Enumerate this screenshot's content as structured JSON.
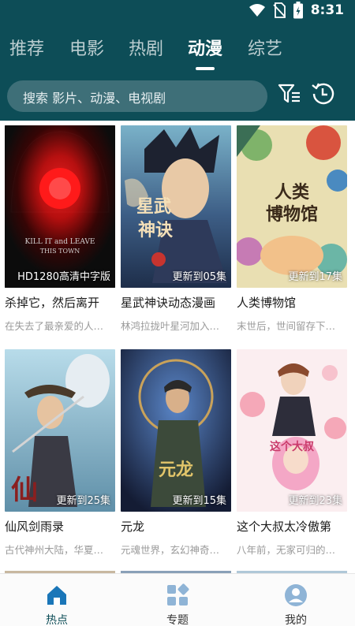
{
  "status_bar": {
    "time": "8:31",
    "icons": [
      "wifi-icon",
      "no-sim-icon",
      "battery-icon"
    ]
  },
  "tabs": [
    {
      "label": "推荐",
      "active": false
    },
    {
      "label": "电影",
      "active": false
    },
    {
      "label": "热剧",
      "active": false
    },
    {
      "label": "动漫",
      "active": true
    },
    {
      "label": "综艺",
      "active": false
    }
  ],
  "search": {
    "placeholder": "搜索 影片、动漫、电视剧"
  },
  "toolbar": {
    "icons": [
      "filter-icon",
      "history-icon"
    ]
  },
  "cards": [
    {
      "title": "杀掉它，然后离开",
      "badge": "HD1280高清中字版",
      "desc": "在失去了最亲爱的人…"
    },
    {
      "title": "星武神诀动态漫画",
      "badge": "更新到05集",
      "desc": "林鸿拉拢叶星河加入…"
    },
    {
      "title": "人类博物馆",
      "badge": "更新到17集",
      "desc": "末世后，世间留存下…"
    },
    {
      "title": "仙风剑雨录",
      "badge": "更新到25集",
      "desc": "古代神州大陆，华夏…"
    },
    {
      "title": "元龙",
      "badge": "更新到15集",
      "desc": "元魂世界，玄幻神奇…"
    },
    {
      "title": "这个大叔太冷傲第",
      "badge": "更新到23集",
      "desc": "八年前，无家可归的…"
    }
  ],
  "bottom_nav": [
    {
      "label": "热点",
      "icon": "home-icon",
      "active": true
    },
    {
      "label": "专题",
      "icon": "topics-icon",
      "active": false
    },
    {
      "label": "我的",
      "icon": "profile-icon",
      "active": false
    }
  ],
  "colors": {
    "header": "#0d4d57",
    "search_bg": "#3e6f78",
    "accent": "#0d4d57"
  }
}
